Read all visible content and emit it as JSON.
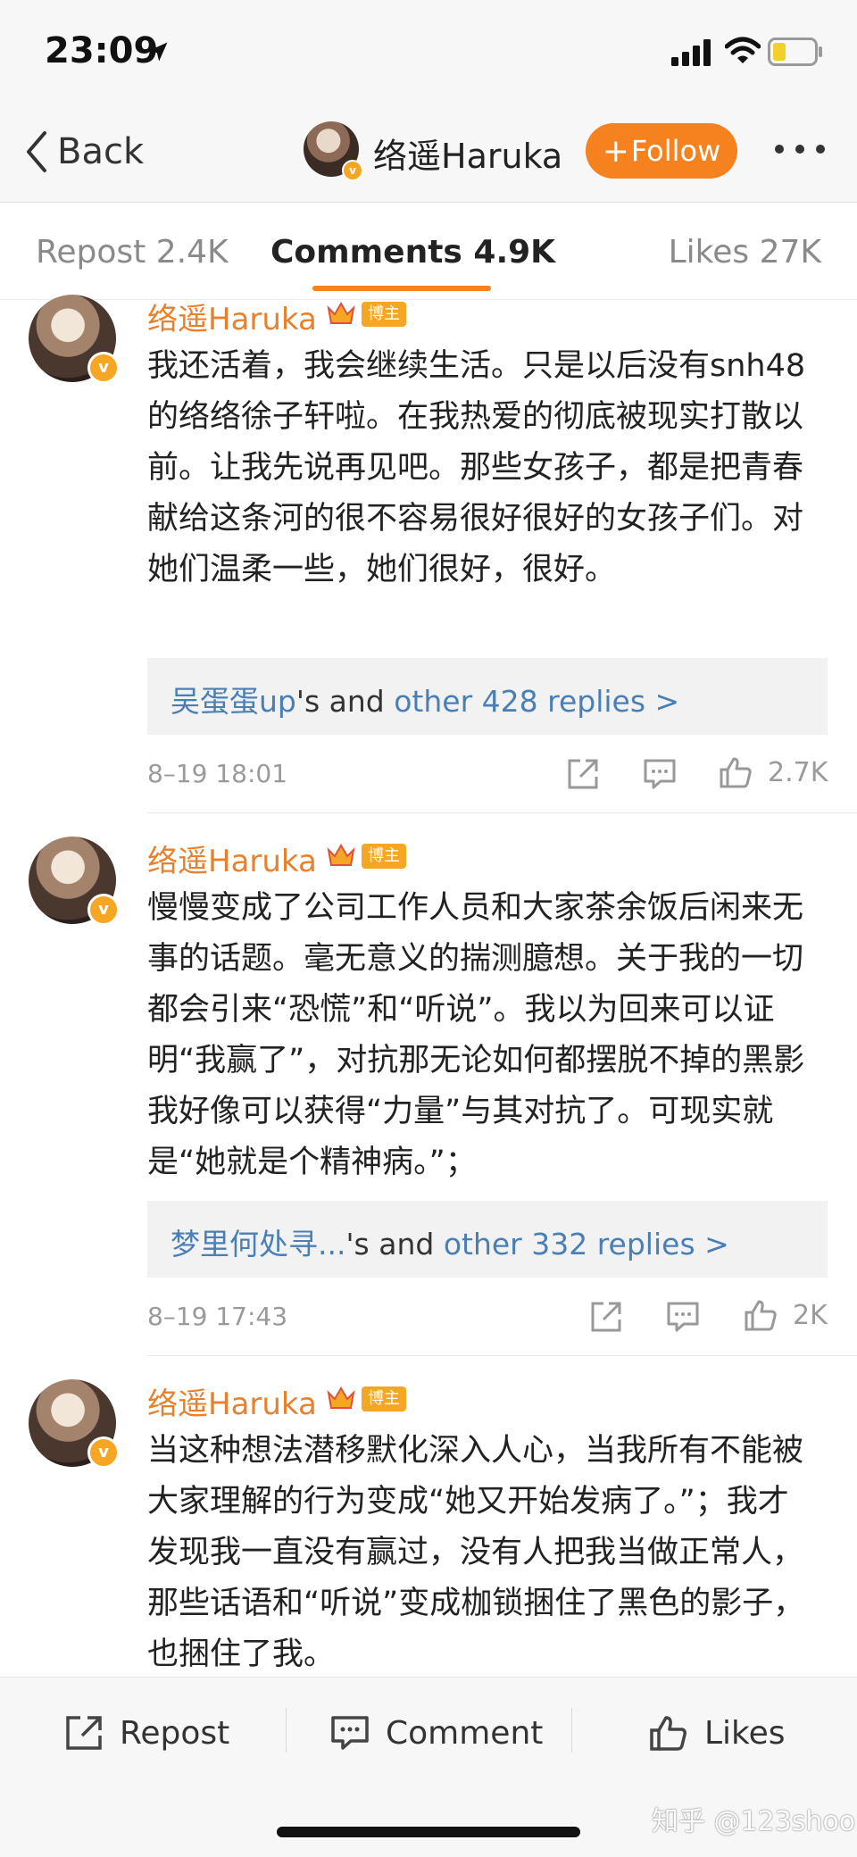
{
  "status_bar": {
    "time": "23:09"
  },
  "nav": {
    "back_label": "Back",
    "username": "络遥Haruka",
    "follow_label": "Follow"
  },
  "tabs": [
    {
      "label": "Repost 2.4K"
    },
    {
      "label": "Comments 4.9K"
    },
    {
      "label": "Likes 27K"
    }
  ],
  "comments": [
    {
      "name": "络遥Haruka",
      "tag": "博主",
      "text": "我还活着，我会继续生活。只是以后没有snh48的络络徐子轩啦。在我热爱的彻底被现实打散以前。让我先说再见吧。那些女孩子，都是把青春献给这条河的很不容易很好很好的女孩子们。对她们温柔一些，她们很好，很好。",
      "reply_user": "吴蛋蛋up",
      "reply_mid": "'s and ",
      "reply_more": "other 428 replies >",
      "date": "8–19 18:01",
      "likes": "2.7K"
    },
    {
      "name": "络遥Haruka",
      "tag": "博主",
      "text": "慢慢变成了公司工作人员和大家茶余饭后闲来无事的话题。毫无意义的揣测臆想。关于我的一切都会引来“恐慌”和“听说”。我以为回来可以证明“我赢了”，对抗那无论如何都摆脱不掉的黑影我好像可以获得“力量”与其对抗了。可现实就是“她就是个精神病。”；",
      "reply_user": "梦里何处寻...",
      "reply_mid": "'s and ",
      "reply_more": "other 332 replies >",
      "date": "8–19 17:43",
      "likes": "2K"
    },
    {
      "name": "络遥Haruka",
      "tag": "博主",
      "text": "当这种想法潜移默化深入人心，当我所有不能被大家理解的行为变成“她又开始发病了。”；我才发现我一直没有赢过，没有人把我当做正常人，那些话语和“听说”变成枷锁捆住了黑色的影子，也捆住了我。"
    }
  ],
  "toolbar": {
    "repost_label": "Repost",
    "comment_label": "Comment",
    "likes_label": "Likes"
  },
  "watermark": "知乎 @123shoo",
  "colors": {
    "accent": "#f6821f",
    "link": "#4a7fb5",
    "name": "#e8812d",
    "verified": "#f5a623"
  },
  "icons": [
    "location-arrow-icon",
    "signal-icon",
    "wifi-icon",
    "battery-icon",
    "back-chevron-icon",
    "more-icon",
    "crown-icon",
    "verified-icon",
    "share-icon",
    "comment-icon",
    "like-icon"
  ]
}
